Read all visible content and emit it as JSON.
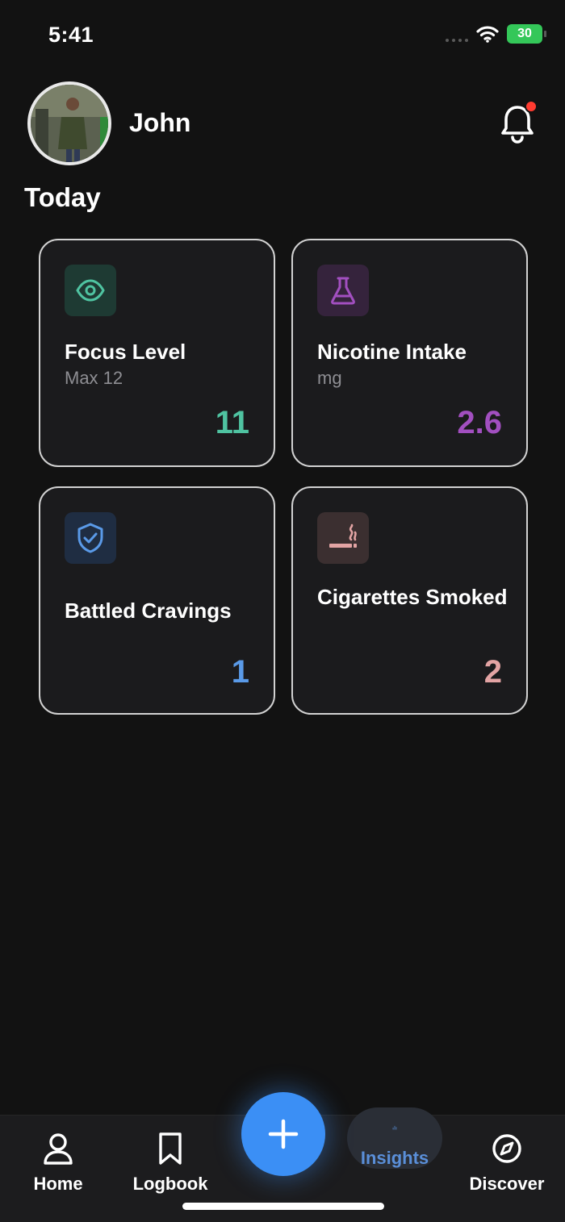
{
  "status_bar": {
    "time": "5:41",
    "battery": "30"
  },
  "header": {
    "user_name": "John",
    "section_title": "Today"
  },
  "cards": [
    {
      "title": "Focus Level",
      "subtitle": "Max 12",
      "value": "11",
      "icon": "eye-icon",
      "accent": "#4fc3a1"
    },
    {
      "title": "Nicotine Intake",
      "subtitle": "mg",
      "value": "2.6",
      "icon": "flask-icon",
      "accent": "#a24fc0"
    },
    {
      "title": "Battled Cravings",
      "subtitle": "",
      "value": "1",
      "icon": "shield-check-icon",
      "accent": "#5a9ae8"
    },
    {
      "title": "Cigarettes Smoked",
      "subtitle": "",
      "value": "2",
      "icon": "smoking-icon",
      "accent": "#e3a4a4"
    }
  ],
  "nav": {
    "home": "Home",
    "logbook": "Logbook",
    "insights": "Insights",
    "discover": "Discover",
    "active": "insights",
    "fab_icon": "plus-icon"
  },
  "colors": {
    "background": "#121212",
    "accent": "#3b8ff5",
    "notification": "#ff3b30"
  }
}
